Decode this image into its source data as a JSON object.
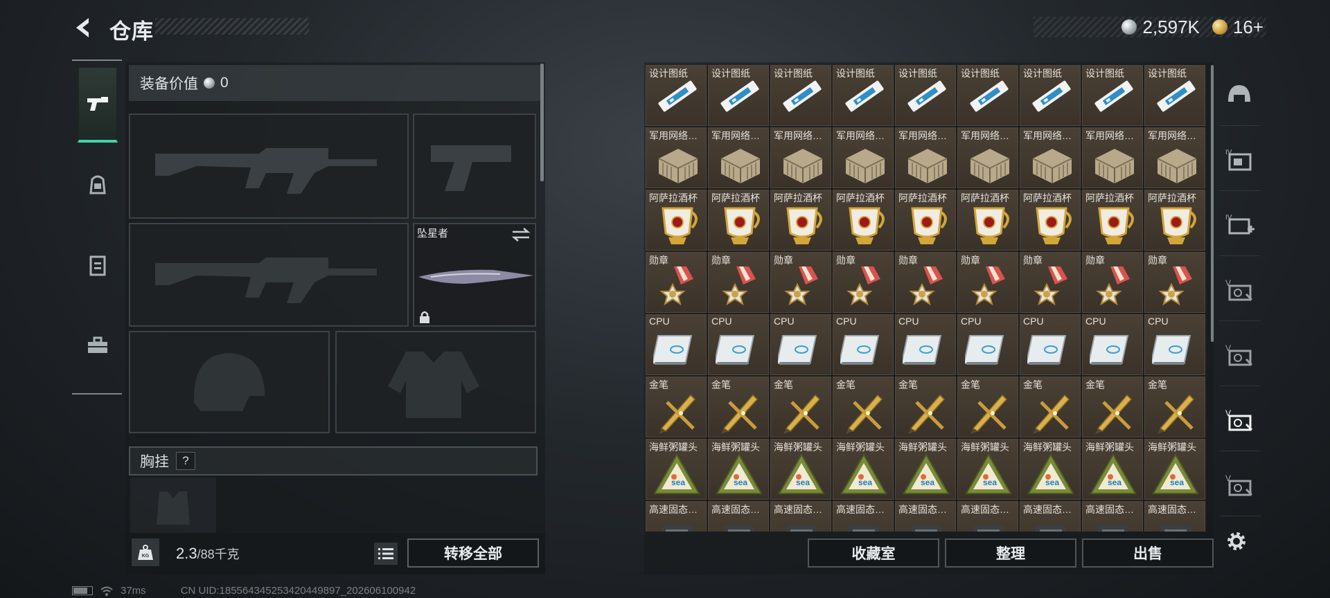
{
  "header": {
    "title": "仓库",
    "currencies": [
      {
        "icon": "silver-coin-icon",
        "value": "2,597K"
      },
      {
        "icon": "gold-coin-icon",
        "value": "16+"
      }
    ]
  },
  "side_tabs": [
    {
      "name": "weapons",
      "icon": "pistol-icon",
      "active": true
    },
    {
      "name": "armor",
      "icon": "backpack-icon",
      "active": false
    },
    {
      "name": "vest",
      "icon": "rig-icon",
      "active": false
    },
    {
      "name": "supplies",
      "icon": "toolbox-icon",
      "active": false
    }
  ],
  "equipment": {
    "value_label": "装备价值",
    "value": "0",
    "melee_label": "坠星者",
    "vest_label": "胸挂",
    "vest_help": "?"
  },
  "weight": {
    "current": "2.3",
    "max": "/88千克",
    "icon_text": "KG"
  },
  "buttons": {
    "move_all": "转移全部",
    "collection": "收藏室",
    "sort": "整理",
    "sell": "出售"
  },
  "status": {
    "ping": "37ms",
    "uid": "CN UID:185564345253420449897_202606100942"
  },
  "inventory": {
    "rows": [
      {
        "label": "设计图纸",
        "icon": "blueprint-icon",
        "count": 9
      },
      {
        "label": "军用网络…",
        "icon": "network-device-icon",
        "count": 9
      },
      {
        "label": "阿萨拉酒杯",
        "icon": "goblet-icon",
        "count": 9
      },
      {
        "label": "勋章",
        "icon": "medal-icon",
        "count": 9
      },
      {
        "label": "CPU",
        "icon": "cpu-icon",
        "count": 9
      },
      {
        "label": "金笔",
        "icon": "gold-pen-icon",
        "count": 9
      },
      {
        "label": "海鲜粥罐头",
        "icon": "seafood-can-icon",
        "count": 9
      },
      {
        "label": "高速固态…",
        "icon": "ssd-icon",
        "count": 9
      }
    ]
  },
  "right_categories": [
    {
      "icon": "helmet-category-icon"
    },
    {
      "icon": "iv-card-icon"
    },
    {
      "icon": "iv-card-plus-icon"
    },
    {
      "icon": "v-card-icon"
    },
    {
      "icon": "v-card-icon"
    },
    {
      "icon": "v-card-active-icon"
    },
    {
      "icon": "v-card-icon"
    }
  ]
}
